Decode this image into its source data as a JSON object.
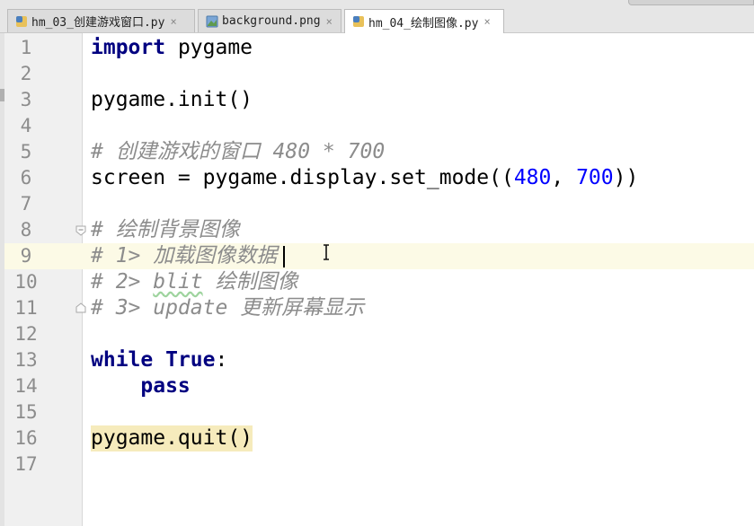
{
  "tabs": [
    {
      "label": "hm_03_创建游戏窗口.py",
      "close": "×",
      "icon": "python-file-icon",
      "active": false
    },
    {
      "label": "background.png",
      "close": "×",
      "icon": "image-file-icon",
      "active": false
    },
    {
      "label": "hm_04_绘制图像.py",
      "close": "×",
      "icon": "python-file-icon",
      "active": true
    }
  ],
  "line_numbers": [
    "1",
    "2",
    "3",
    "4",
    "5",
    "6",
    "7",
    "8",
    "9",
    "10",
    "11",
    "12",
    "13",
    "14",
    "15",
    "16",
    "17"
  ],
  "code": {
    "l1_kw": "import",
    "l1_rest": " pygame",
    "l3": "pygame.init()",
    "l5": "# 创建游戏的窗口 480 * 700",
    "l6_a": "screen = pygame.display.set_mode((",
    "l6_n1": "480",
    "l6_b": ", ",
    "l6_n2": "700",
    "l6_c": "))",
    "l8": "# 绘制背景图像",
    "l9": "# 1> 加载图像数据",
    "l10_a": "# 2> ",
    "l10_blit": "blit",
    "l10_b": " 绘制图像",
    "l11": "# 3> update 更新屏幕显示",
    "l13_kw1": "while",
    "l13_sp": " ",
    "l13_kw2": "True",
    "l13_colon": ":",
    "l14_indent": "    ",
    "l14_kw": "pass",
    "l16": "pygame.quit()"
  },
  "colors": {
    "keyword": "#000080",
    "number": "#0000ff",
    "comment": "#8c8c8c",
    "current_line": "#fcfae6"
  },
  "cursor": {
    "line": 9
  }
}
